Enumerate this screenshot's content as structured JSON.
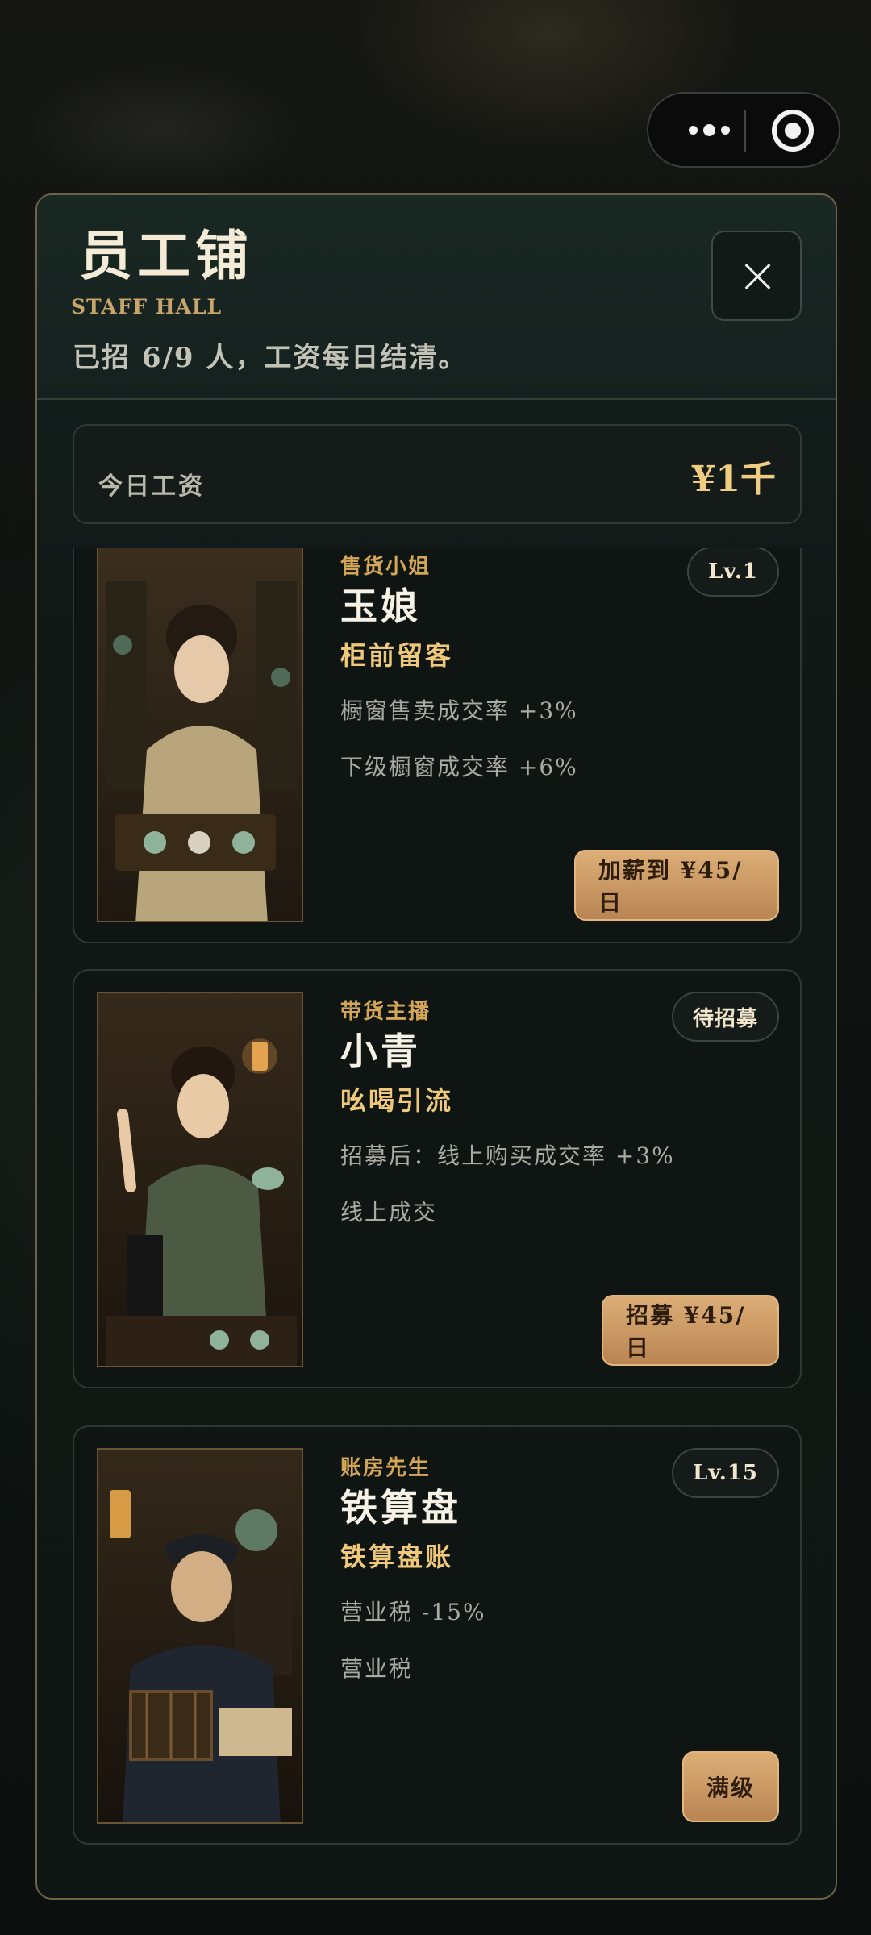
{
  "capsule": {
    "more_icon": "more-dots-icon",
    "target_icon": "target-circle-icon"
  },
  "header": {
    "title": "员工铺",
    "subtitle_en": "STAFF HALL",
    "description": "已招 6/9 人，工资每日结清。",
    "close_icon": "close-icon"
  },
  "wage": {
    "label": "今日工资",
    "value": "¥1千"
  },
  "staff": [
    {
      "role": "售货小姐",
      "name": "玉娘",
      "skill": "柜前留客",
      "effects": [
        "橱窗售卖成交率 +3%",
        "下级橱窗成交率 +6%"
      ],
      "badge": "Lv.1",
      "action": "加薪到 ¥45/日"
    },
    {
      "role": "带货主播",
      "name": "小青",
      "skill": "吆喝引流",
      "effects": [
        "招募后：线上购买成交率 +3%",
        "线上成交"
      ],
      "badge": "待招募",
      "action": "招募 ¥45/日"
    },
    {
      "role": "账房先生",
      "name": "铁算盘",
      "skill": "铁算盘账",
      "effects": [
        "营业税 -15%",
        "营业税"
      ],
      "badge": "Lv.15",
      "action": "满级"
    }
  ],
  "colors": {
    "accent_gold": "#f0c879",
    "button_brown": "#c8956a",
    "panel_border": "#6b6447"
  }
}
